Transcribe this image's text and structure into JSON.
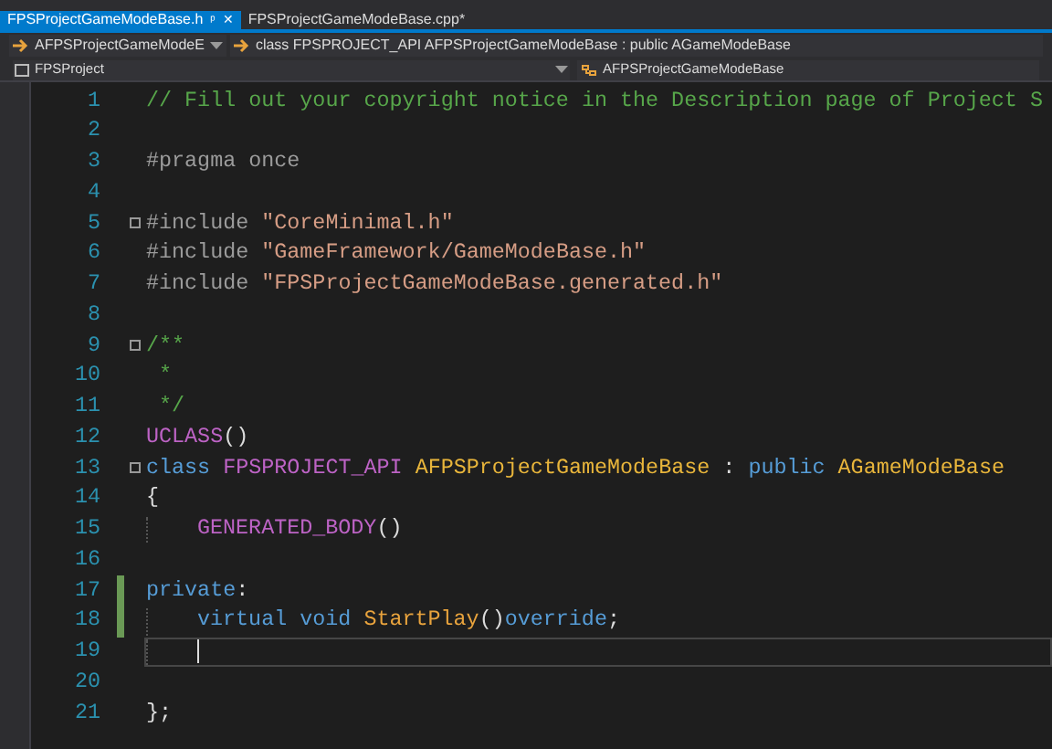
{
  "tabs": [
    {
      "label": "FPSProjectGameModeBase.h",
      "selected": true,
      "pin": "ᵖ",
      "close": "✕"
    },
    {
      "label": "FPSProjectGameModeBase.cpp*",
      "selected": false
    }
  ],
  "nav_bar": {
    "scope": "AFPSProjectGameModeE",
    "member": "class FPSPROJECT_API AFPSProjectGameModeBase : public AGameModeBase"
  },
  "project_bar": {
    "project": "FPSProject",
    "class": "AFPSProjectGameModeBase"
  },
  "lines": [
    {
      "number": "1",
      "current": false,
      "changed": false,
      "foldable": false,
      "indented": false,
      "tokens": [
        {
          "text": "// Fill out your copyright notice in the Description page of Project S",
          "kind": "comment"
        }
      ]
    },
    {
      "number": "2",
      "current": false,
      "changed": false,
      "foldable": false,
      "indented": false
    },
    {
      "number": "3",
      "current": false,
      "changed": false,
      "foldable": false,
      "indented": false,
      "tokens": [
        {
          "text": "#pragma once",
          "kind": "preproc"
        }
      ]
    },
    {
      "number": "4",
      "current": false,
      "changed": false,
      "foldable": false,
      "indented": false
    },
    {
      "number": "5",
      "current": false,
      "changed": false,
      "foldable": true,
      "indented": false,
      "tokens": [
        {
          "text": "#include ",
          "kind": "preproc"
        },
        {
          "text": "\"CoreMinimal.h\"",
          "kind": "string"
        }
      ]
    },
    {
      "number": "6",
      "current": false,
      "changed": false,
      "foldable": false,
      "indented": false,
      "tokens": [
        {
          "text": "#include ",
          "kind": "preproc"
        },
        {
          "text": "\"GameFramework/GameModeBase.h\"",
          "kind": "string"
        }
      ]
    },
    {
      "number": "7",
      "current": false,
      "changed": false,
      "foldable": false,
      "indented": false,
      "tokens": [
        {
          "text": "#include ",
          "kind": "preproc"
        },
        {
          "text": "\"FPSProjectGameModeBase.generated.h\"",
          "kind": "string"
        }
      ]
    },
    {
      "number": "8",
      "current": false,
      "changed": false,
      "foldable": false,
      "indented": false
    },
    {
      "number": "9",
      "current": false,
      "changed": false,
      "foldable": true,
      "indented": false,
      "tokens": [
        {
          "text": "/**",
          "kind": "comment"
        }
      ]
    },
    {
      "number": "10",
      "current": false,
      "changed": false,
      "foldable": false,
      "indented": false,
      "tokens": [
        {
          "text": " *",
          "kind": "comment"
        }
      ]
    },
    {
      "number": "11",
      "current": false,
      "changed": false,
      "foldable": false,
      "indented": false,
      "tokens": [
        {
          "text": " */",
          "kind": "comment"
        }
      ]
    },
    {
      "number": "12",
      "current": false,
      "changed": false,
      "foldable": false,
      "indented": false,
      "tokens": [
        {
          "text": "UCLASS",
          "kind": "macro"
        },
        {
          "text": "()",
          "kind": "plain"
        }
      ]
    },
    {
      "number": "13",
      "current": false,
      "changed": false,
      "foldable": true,
      "indented": false,
      "tokens": [
        {
          "text": "class ",
          "kind": "keyword"
        },
        {
          "text": "FPSPROJECT_API ",
          "kind": "macro"
        },
        {
          "text": "AFPSProjectGameModeBase",
          "kind": "type"
        },
        {
          "text": " : ",
          "kind": "plain"
        },
        {
          "text": "public ",
          "kind": "keyword"
        },
        {
          "text": "AGameModeBase",
          "kind": "type"
        }
      ]
    },
    {
      "number": "14",
      "current": false,
      "changed": false,
      "foldable": false,
      "indented": false,
      "tokens": [
        {
          "text": "{",
          "kind": "plain"
        }
      ]
    },
    {
      "number": "15",
      "current": false,
      "changed": false,
      "foldable": false,
      "indented": true,
      "tokens": [
        {
          "text": "GENERATED_BODY",
          "kind": "macro"
        },
        {
          "text": "()",
          "kind": "plain"
        }
      ]
    },
    {
      "number": "16",
      "current": false,
      "changed": false,
      "foldable": false,
      "indented": false
    },
    {
      "number": "17",
      "current": false,
      "changed": true,
      "foldable": false,
      "indented": false,
      "tokens": [
        {
          "text": "private",
          "kind": "keyword"
        },
        {
          "text": ":",
          "kind": "plain"
        }
      ]
    },
    {
      "number": "18",
      "current": false,
      "changed": true,
      "foldable": false,
      "indented": true,
      "tokens": [
        {
          "text": "virtual void ",
          "kind": "keyword"
        },
        {
          "text": "StartPlay",
          "kind": "function"
        },
        {
          "text": "()",
          "kind": "plain"
        },
        {
          "text": "override",
          "kind": "keyword"
        },
        {
          "text": ";",
          "kind": "plain"
        }
      ]
    },
    {
      "number": "19",
      "current": true,
      "changed": false,
      "foldable": false,
      "indented": true
    },
    {
      "number": "20",
      "current": false,
      "changed": false,
      "foldable": false,
      "indented": false
    },
    {
      "number": "21",
      "current": false,
      "changed": false,
      "foldable": false,
      "indented": false,
      "tokens": [
        {
          "text": "};",
          "kind": "plain"
        }
      ]
    }
  ]
}
